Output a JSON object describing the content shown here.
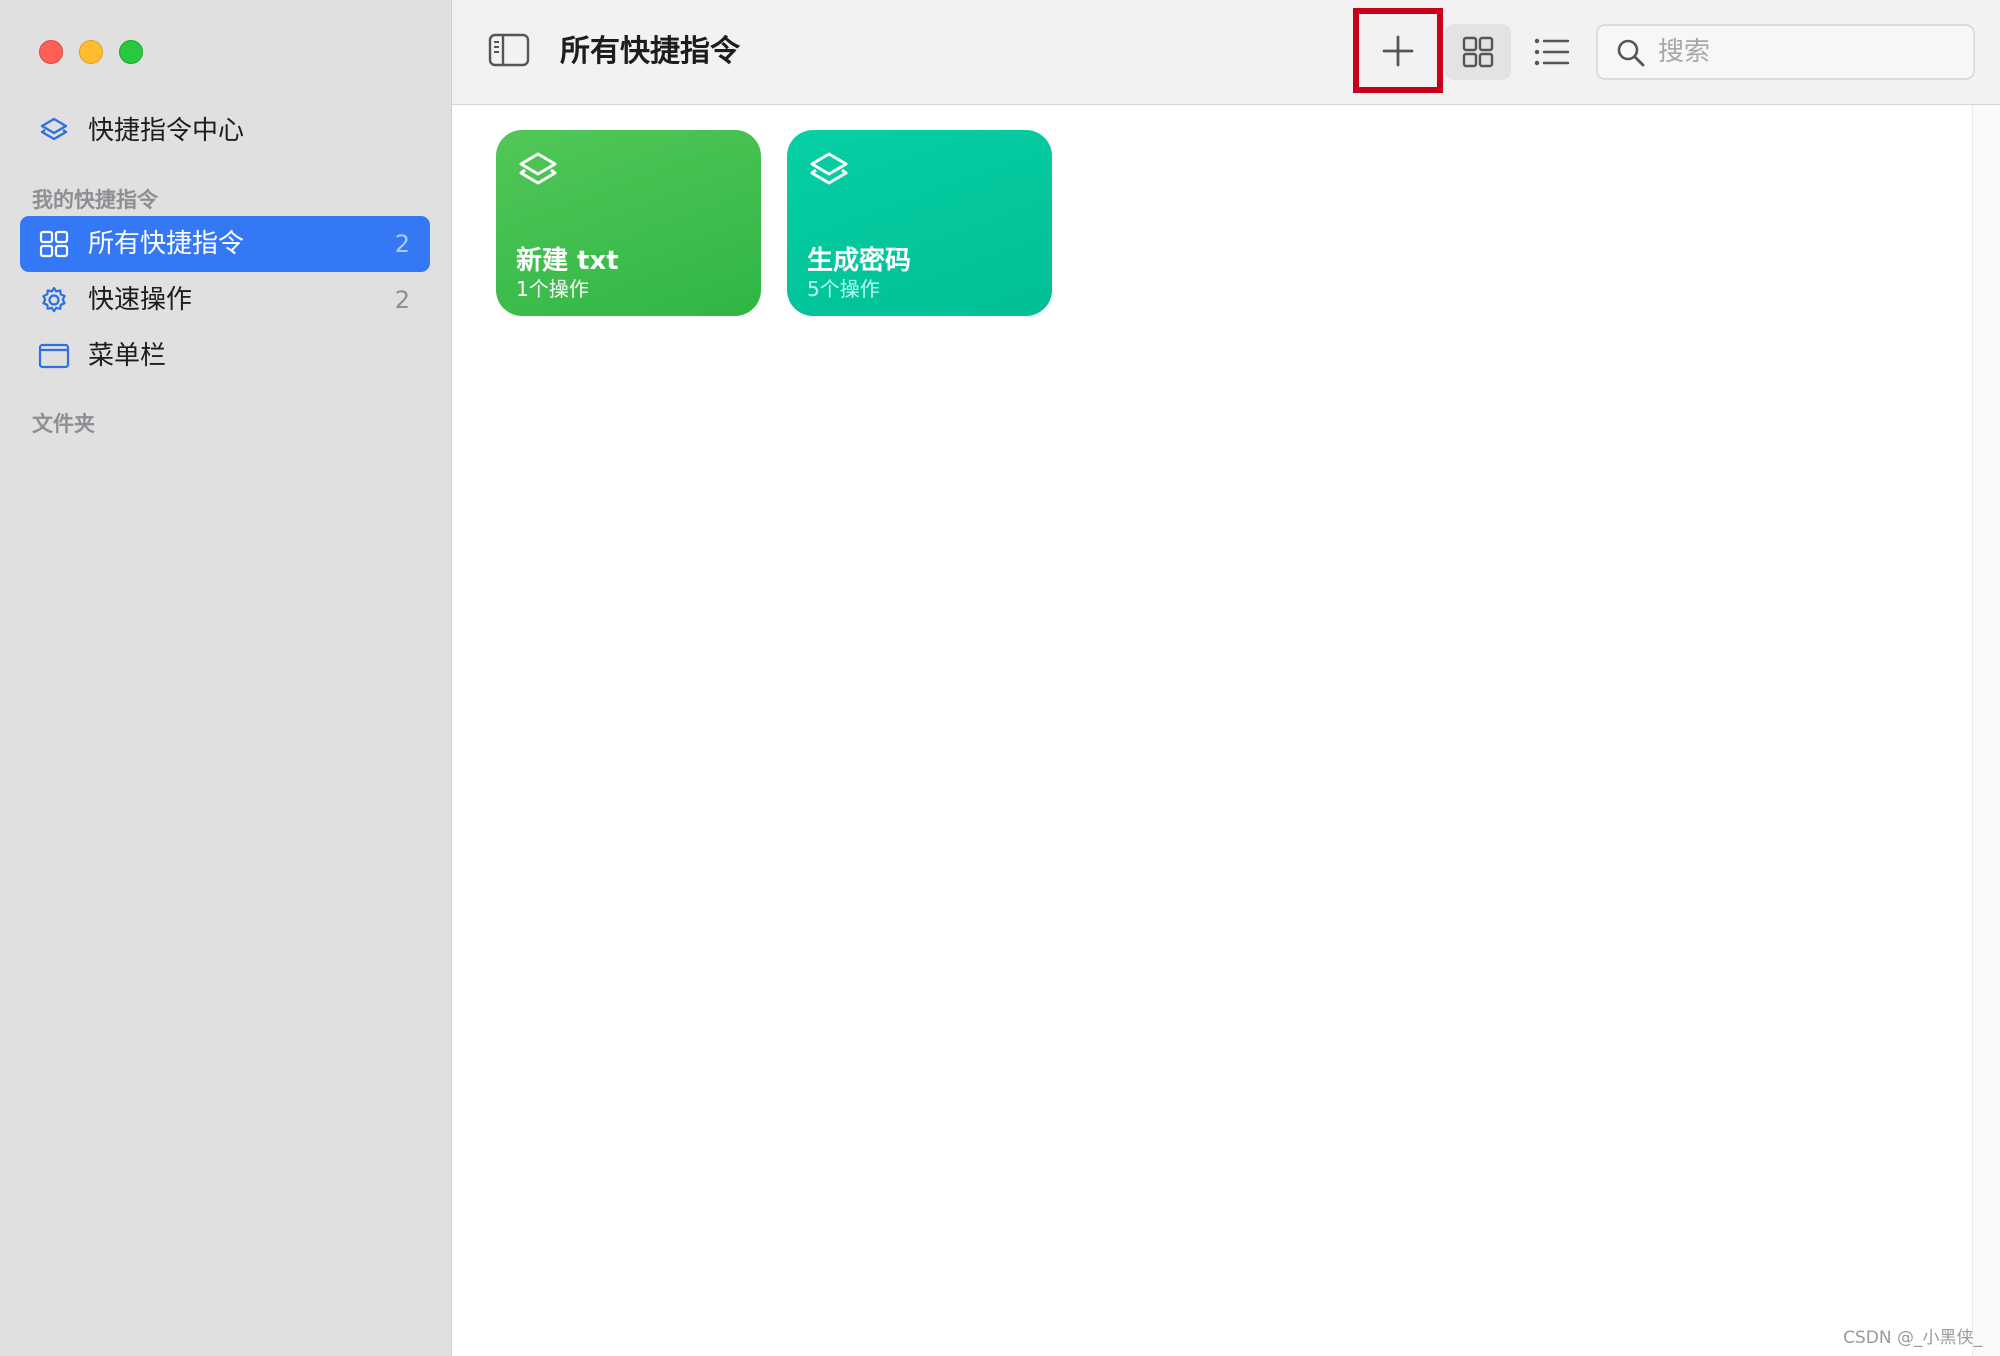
{
  "window": {
    "controls": [
      "close",
      "minimize",
      "zoom"
    ]
  },
  "sidebar": {
    "gallery": {
      "label": "快捷指令中心",
      "icon": "shortcuts-icon"
    },
    "section_my_shortcuts": "我的快捷指令",
    "items": [
      {
        "label": "所有快捷指令",
        "count": "2",
        "icon": "grid-icon",
        "selected": true
      },
      {
        "label": "快速操作",
        "count": "2",
        "icon": "gear-icon",
        "selected": false
      },
      {
        "label": "菜单栏",
        "count": "",
        "icon": "menubar-icon",
        "selected": false
      }
    ],
    "section_folders": "文件夹"
  },
  "toolbar": {
    "title": "所有快捷指令",
    "add_icon": "plus-icon",
    "view_grid_icon": "grid-view-icon",
    "view_list_icon": "list-view-icon",
    "search_placeholder": "搜索"
  },
  "shortcuts": [
    {
      "title": "新建 txt",
      "subtitle": "1个操作",
      "color": "#34c759"
    },
    {
      "title": "生成密码",
      "subtitle": "5个操作",
      "color": "#00c7a0"
    }
  ],
  "colors": {
    "accent": "#3478f6",
    "highlight_box": "#c8001b"
  },
  "watermark": "CSDN @_小黑侠_"
}
